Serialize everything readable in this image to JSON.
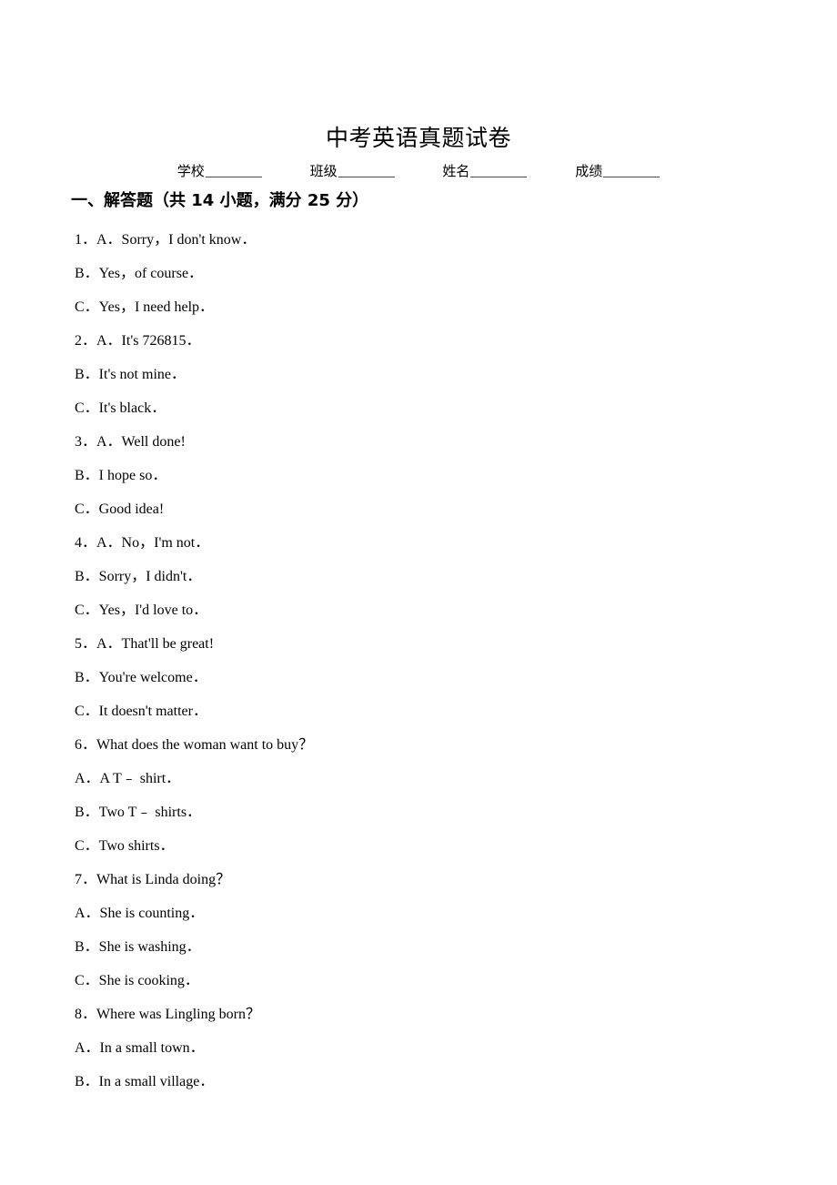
{
  "document": {
    "title": "中考英语真题试卷",
    "info_fields": [
      {
        "label": "学校",
        "value": ""
      },
      {
        "label": "班级",
        "value": ""
      },
      {
        "label": "姓名",
        "value": ""
      },
      {
        "label": "成绩",
        "value": ""
      }
    ],
    "section_heading": "一、解答题（共 14 小题，满分 25 分）",
    "lines": [
      {
        "id": "l1",
        "text": "1．A．Sorry，I don't know．"
      },
      {
        "id": "l2",
        "text": "B．Yes，of course．"
      },
      {
        "id": "l3",
        "text": "C．Yes，I need help．"
      },
      {
        "id": "l4",
        "text": "2．A．It's 726815．"
      },
      {
        "id": "l5",
        "text": "B．It's not mine．"
      },
      {
        "id": "l6",
        "text": "C．It's black．"
      },
      {
        "id": "l7",
        "text": "3．A．Well done!"
      },
      {
        "id": "l8",
        "text": "B．I hope so．"
      },
      {
        "id": "l9",
        "text": "C．Good idea!"
      },
      {
        "id": "l10",
        "text": "4．A．No，I'm not．"
      },
      {
        "id": "l11",
        "text": "B．Sorry，I didn't．"
      },
      {
        "id": "l12",
        "text": "C．Yes，I'd love to．"
      },
      {
        "id": "l13",
        "text": "5．A．That'll be great!"
      },
      {
        "id": "l14",
        "text": "B．You're welcome．"
      },
      {
        "id": "l15",
        "text": "C．It doesn't matter．"
      },
      {
        "id": "l16",
        "text": "6．What does the woman want to buy？"
      },
      {
        "id": "l17",
        "text": "A．A T﹣ shirt．"
      },
      {
        "id": "l18",
        "text": "B．Two T﹣ shirts．"
      },
      {
        "id": "l19",
        "text": "C．Two shirts．"
      },
      {
        "id": "l20",
        "text": "7．What is Linda doing？"
      },
      {
        "id": "l21",
        "text": "A．She is counting．"
      },
      {
        "id": "l22",
        "text": "B．She is washing．"
      },
      {
        "id": "l23",
        "text": "C．She is cooking．"
      },
      {
        "id": "l24",
        "text": "8．Where was Lingling born？"
      },
      {
        "id": "l25",
        "text": "A．In a small town．"
      },
      {
        "id": "l26",
        "text": "B．In a small village．"
      }
    ]
  }
}
